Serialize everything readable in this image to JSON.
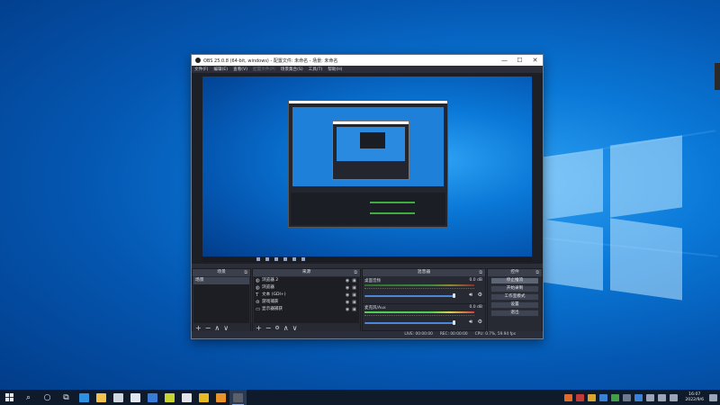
{
  "window": {
    "title": "OBS 25.0.8 (64-bit, windows) - 配置文件: 未命名 - 场景: 未命名",
    "minimize": "—",
    "maximize": "☐",
    "close": "✕"
  },
  "menu": [
    {
      "label": "文件(F)",
      "enabled": true
    },
    {
      "label": "编辑(E)",
      "enabled": true
    },
    {
      "label": "查看(V)",
      "enabled": true
    },
    {
      "label": "配置文件(P)",
      "enabled": false
    },
    {
      "label": "场景集合(S)",
      "enabled": true
    },
    {
      "label": "工具(T)",
      "enabled": true
    },
    {
      "label": "帮助(H)",
      "enabled": true
    }
  ],
  "docks": {
    "scenes": {
      "title": "场景",
      "items": [
        "场景"
      ]
    },
    "sources": {
      "title": "来源",
      "items": [
        {
          "label": "浏览器 2",
          "icon": "globe-icon"
        },
        {
          "label": "浏览器",
          "icon": "globe-icon"
        },
        {
          "label": "文本 (GDI+)",
          "icon": "text-icon"
        },
        {
          "label": "游戏捕获",
          "icon": "gamepad-icon"
        },
        {
          "label": "显示器捕获",
          "icon": "monitor-icon"
        }
      ]
    },
    "mixer": {
      "title": "混音器",
      "channels": [
        {
          "name": "桌面音频",
          "db": "0.0 dB",
          "level": 0.0
        },
        {
          "name": "麦克风/Aux",
          "db": "0.0 dB",
          "level": 0.55
        }
      ]
    },
    "controls": {
      "title": "控件",
      "buttons": [
        "停止推流",
        "开始录制",
        "工作室模式",
        "设置",
        "退出"
      ]
    }
  },
  "footer_glyphs": {
    "add": "+",
    "remove": "−",
    "up": "∧",
    "down": "∨",
    "settings": "⚙"
  },
  "status": {
    "live": "LIVE: 00:00:00",
    "rec": "REC: 00:00:00",
    "cpu": "CPU: 0.7%, 59.94 fps"
  },
  "taskbar": {
    "start_icon": "windows-icon",
    "search_icon": "⌕",
    "cortana_icon": "○",
    "taskview_icon": "⧉",
    "apps": [
      {
        "name": "edge-icon",
        "color": "#2f8fe0"
      },
      {
        "name": "file-explorer-icon",
        "color": "#f2c14e"
      },
      {
        "name": "store-icon",
        "color": "#cfd6e0"
      },
      {
        "name": "mail-icon",
        "color": "#dfe6ef"
      },
      {
        "name": "photos-icon",
        "color": "#3a7bd5"
      },
      {
        "name": "green-app-icon",
        "color": "#c8d432"
      },
      {
        "name": "tool-app-icon",
        "color": "#e0e4ea"
      },
      {
        "name": "yellow-app-icon",
        "color": "#e8b923"
      },
      {
        "name": "orange-app-icon",
        "color": "#e8942b"
      },
      {
        "name": "obs-icon",
        "color": "#5a5f6a"
      }
    ],
    "time": "16:07",
    "date": "2022/9/6"
  },
  "colors": {
    "obs_bg": "#2b2e38",
    "accent": "#4d86d6",
    "desktop": "#0a78d7"
  }
}
